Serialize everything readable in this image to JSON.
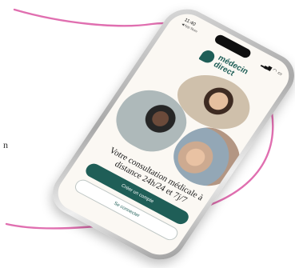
{
  "status_bar": {
    "time": "11:40",
    "carrier": "◀ App Store",
    "signal_icon": "signal-icon",
    "wifi_icon": "wifi-icon",
    "battery_icon": "battery-icon"
  },
  "brand": {
    "name_line1": "médecin",
    "name_line2": "direct",
    "color": "#1f5e57"
  },
  "hero": {
    "headline": "Votre consultation médicale à distance 24h/24 et 7j/7"
  },
  "actions": {
    "primary_label": "Créer un compte",
    "secondary_label": "Se connecter"
  },
  "background": {
    "left_char": "n",
    "loop_color": "#e06fb0"
  }
}
